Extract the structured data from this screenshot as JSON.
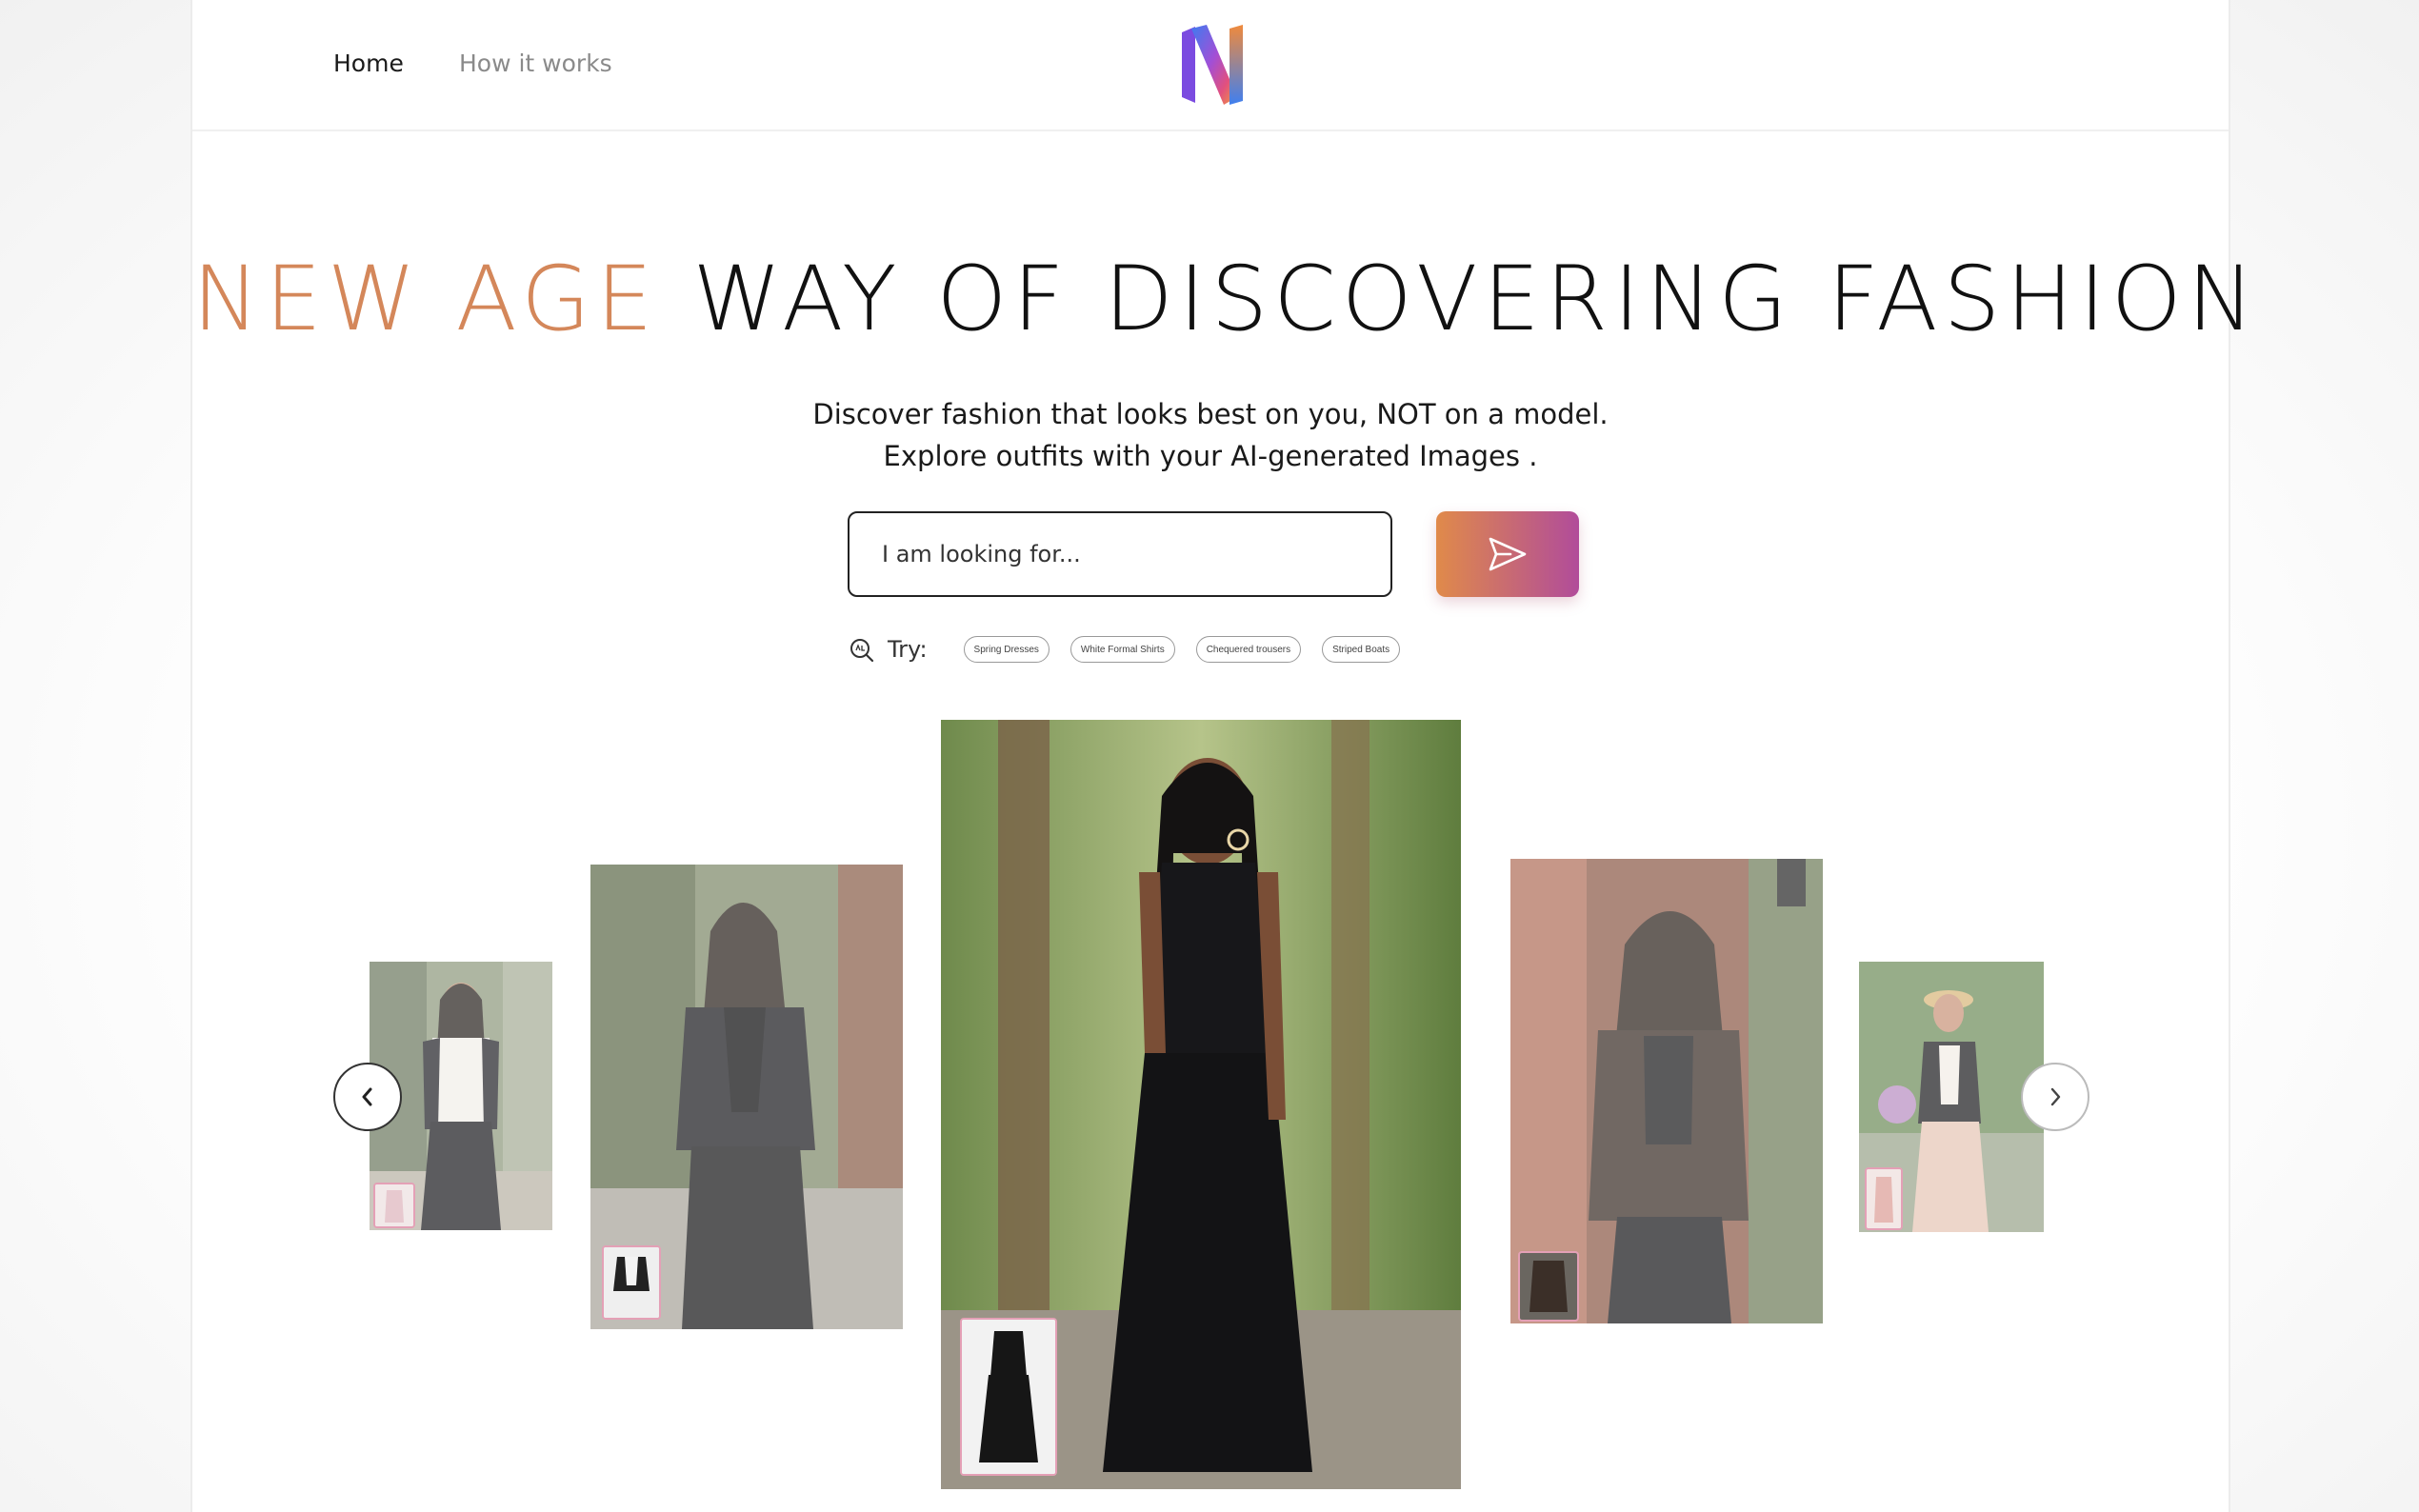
{
  "nav": {
    "home": "Home",
    "how_it_works": "How it works"
  },
  "hero": {
    "title_accent": "NEW AGE",
    "title_rest": "WAY OF DISCOVERING FASHION",
    "subtitle_1": "Discover fashion that looks best on you, NOT on a model.",
    "subtitle_2": "Explore outfits with your AI-generated Images ."
  },
  "search": {
    "placeholder": "I am looking for..."
  },
  "try": {
    "label": "Try:",
    "chips": [
      "Spring Dresses",
      "White Formal Shirts",
      "Chequered trousers",
      "Striped Boats"
    ]
  },
  "colors": {
    "accent": "#d4875a",
    "gradient_start": "#e08a4a",
    "gradient_end": "#b14c9a"
  },
  "icons": {
    "send": "paper-plane-icon",
    "try": "search-sparkle-icon",
    "prev": "chevron-left-icon",
    "next": "chevron-right-icon"
  }
}
